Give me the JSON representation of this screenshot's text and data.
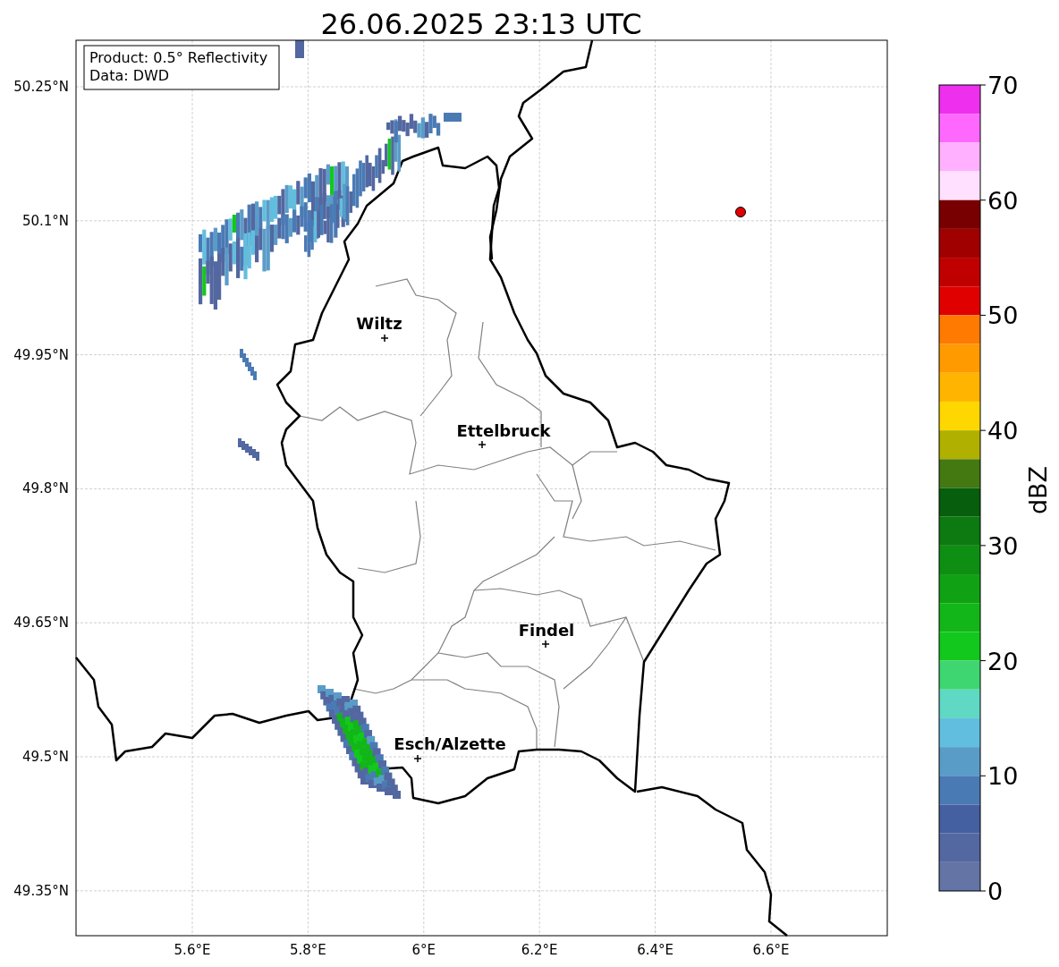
{
  "title": "26.06.2025 23:13 UTC",
  "info_box": [
    "Product: 0.5° Reflectivity",
    "Data: DWD"
  ],
  "latitude_labels": [
    "50.25°N",
    "50.1°N",
    "49.95°N",
    "49.8°N",
    "49.65°N",
    "49.5°N",
    "49.35°N"
  ],
  "longitude_labels": [
    "5.6°E",
    "5.8°E",
    "6°E",
    "6.2°E",
    "6.4°E",
    "6.6°E"
  ],
  "cities": [
    {
      "name": "Wiltz"
    },
    {
      "name": "Ettelbruck"
    },
    {
      "name": "Findel"
    },
    {
      "name": "Esch/Alzette"
    }
  ],
  "colorbar": {
    "label": "dBZ",
    "ticks": [
      "70",
      "60",
      "50",
      "40",
      "30",
      "20",
      "10",
      "0"
    ],
    "bins": [
      {
        "color": "#ee30ee"
      },
      {
        "color": "#ff68ff"
      },
      {
        "color": "#ffb0ff"
      },
      {
        "color": "#ffe0ff"
      },
      {
        "color": "#780000"
      },
      {
        "color": "#a00000"
      },
      {
        "color": "#c00000"
      },
      {
        "color": "#e00000"
      },
      {
        "color": "#ff7a00"
      },
      {
        "color": "#ff9a00"
      },
      {
        "color": "#ffb400"
      },
      {
        "color": "#ffd700"
      },
      {
        "color": "#b0b000"
      },
      {
        "color": "#447810"
      },
      {
        "color": "#075e0c"
      },
      {
        "color": "#0c7a10"
      },
      {
        "color": "#0f8e14"
      },
      {
        "color": "#10a214"
      },
      {
        "color": "#12b618"
      },
      {
        "color": "#13c81c"
      },
      {
        "color": "#3dd670"
      },
      {
        "color": "#5fd8c4"
      },
      {
        "color": "#62bede"
      },
      {
        "color": "#5a9cc8"
      },
      {
        "color": "#4a7ab4"
      },
      {
        "color": "#4560a0"
      },
      {
        "color": "#5367a0"
      },
      {
        "color": "#6374a5"
      }
    ]
  }
}
